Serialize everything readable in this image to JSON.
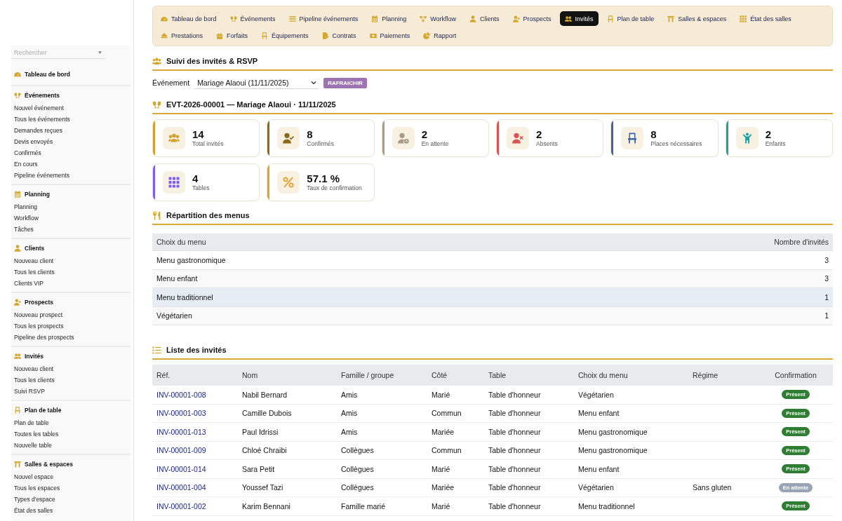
{
  "nav": {
    "tabs": [
      {
        "label": "Tableau de bord",
        "selected": false
      },
      {
        "label": "Événements",
        "selected": false
      },
      {
        "label": "Pipeline événements",
        "selected": false
      },
      {
        "label": "Planning",
        "selected": false
      },
      {
        "label": "Workflow",
        "selected": false
      },
      {
        "label": "Clients",
        "selected": false
      },
      {
        "label": "Prospects",
        "selected": false
      },
      {
        "label": "Invités",
        "selected": true
      },
      {
        "label": "Plan de table",
        "selected": false
      },
      {
        "label": "Salles & espaces",
        "selected": false
      },
      {
        "label": "État des salles",
        "selected": false
      },
      {
        "label": "Prestations",
        "selected": false
      },
      {
        "label": "Forfaits",
        "selected": false
      },
      {
        "label": "Équipements",
        "selected": false
      },
      {
        "label": "Contrats",
        "selected": false
      },
      {
        "label": "Paiements",
        "selected": false
      },
      {
        "label": "Rapport",
        "selected": false
      }
    ]
  },
  "sidebar": {
    "search": {
      "placeholder": "Rechercher"
    },
    "groups": [
      {
        "label": "Tableau de bord"
      },
      {
        "label": "Événements",
        "items": [
          "Nouvel événement",
          "Tous les événements",
          "Demandes reçues",
          "Devis envoyés",
          "Confirmés",
          "En cours",
          "Pipeline événements"
        ]
      },
      {
        "label": "Planning",
        "items": [
          "Planning",
          "Workflow",
          "Tâches"
        ]
      },
      {
        "label": "Clients",
        "items": [
          "Nouveau client",
          "Tous les clients",
          "Clients VIP"
        ]
      },
      {
        "label": "Prospects",
        "items": [
          "Nouveau prospect",
          "Tous les prospects",
          "Pipeline des prospects"
        ]
      },
      {
        "label": "Invités",
        "items": [
          "Nouveau client",
          "Tous les clients",
          "Suivi RSVP"
        ]
      },
      {
        "label": "Plan de table",
        "items": [
          "Plan de table",
          "Toutes les tables",
          "Nouvelle table"
        ]
      },
      {
        "label": "Salles & espaces",
        "items": [
          "Nouvel espace",
          "Tous les espaces",
          "Types d'espace",
          "État des salles"
        ]
      }
    ]
  },
  "page": {
    "title": "Suivi des invités & RSVP"
  },
  "event_picker": {
    "label": "Événement",
    "value": "Mariage Alaoui (11/11/2025)",
    "button": "RAFRAICHIR"
  },
  "event": {
    "title": "EVT-2026-00001 — Mariage Alaoui · 11/11/2025"
  },
  "stats": [
    {
      "value": "14",
      "label": "Total invités",
      "color": "#cfa22e"
    },
    {
      "value": "8",
      "label": "Confirmés",
      "color": "#8a6a17"
    },
    {
      "value": "2",
      "label": "En attente",
      "color": "#a89c86"
    },
    {
      "value": "2",
      "label": "Absents",
      "color": "#d9534f"
    },
    {
      "value": "8",
      "label": "Places nécessaires",
      "color": "#3f63a6"
    },
    {
      "value": "2",
      "label": "Enfants",
      "color": "#1aa3a3"
    },
    {
      "value": "4",
      "label": "Tables",
      "color": "#7c5cf2"
    },
    {
      "value": "57.1 %",
      "label": "Taux de confirmation",
      "color": "#e2a12f"
    }
  ],
  "menu_section": {
    "title": "Répartition des menus",
    "columns": [
      "Choix du menu",
      "Nombre d'invités"
    ],
    "rows": [
      {
        "cells": [
          "Menu gastronomique",
          "3"
        ],
        "highlighted": false
      },
      {
        "cells": [
          "Menu enfant",
          "3"
        ],
        "highlighted": false
      },
      {
        "cells": [
          "Menu traditionnel",
          "1"
        ],
        "highlighted": true
      },
      {
        "cells": [
          "Végétarien",
          "1"
        ],
        "highlighted": false
      }
    ]
  },
  "guest_section": {
    "title": "Liste des invités",
    "columns": [
      "Réf.",
      "Nom",
      "Famille / groupe",
      "Côté",
      "Table",
      "Choix du menu",
      "Régime",
      "Confirmation"
    ],
    "rows": [
      {
        "ref": "INV-00001-008",
        "name": "Nabil Bernard",
        "group": "Amis",
        "side": "Marié",
        "table": "Table d'honneur",
        "menu": "Végétarien",
        "confirmation": {
          "label": "Présent",
          "color": "#2e7d32"
        }
      },
      {
        "ref": "INV-00001-003",
        "name": "Camille Dubois",
        "group": "Amis",
        "side": "Commun",
        "table": "Table d'honneur",
        "menu": "Menu enfant",
        "confirmation": {
          "label": "Présent",
          "color": "#2e7d32"
        }
      },
      {
        "ref": "INV-00001-013",
        "name": "Paul Idrissi",
        "group": "Amis",
        "side": "Mariée",
        "table": "Table d'honneur",
        "menu": "Menu gastronomique",
        "confirmation": {
          "label": "Présent",
          "color": "#2e7d32"
        }
      },
      {
        "ref": "INV-00001-009",
        "name": "Chloé Chraibi",
        "group": "Collègues",
        "side": "Commun",
        "table": "Table d'honneur",
        "menu": "Menu gastronomique",
        "confirmation": {
          "label": "Présent",
          "color": "#2e7d32"
        }
      },
      {
        "ref": "INV-00001-014",
        "name": "Sara Petit",
        "group": "Collègues",
        "side": "Marié",
        "table": "Table d'honneur",
        "menu": "Menu enfant",
        "confirmation": {
          "label": "Présent",
          "color": "#2e7d32"
        }
      },
      {
        "ref": "INV-00001-004",
        "name": "Youssef Tazi",
        "group": "Collègues",
        "side": "Mariée",
        "table": "Table d'honneur",
        "menu": "Végétarien",
        "diet": "Sans gluten",
        "confirmation": {
          "label": "En attente",
          "color": "#98a4b6"
        }
      },
      {
        "ref": "INV-00001-002",
        "name": "Karim Bennani",
        "group": "Famille marié",
        "side": "Marié",
        "table": "Table d'honneur",
        "menu": "Menu traditionnel",
        "confirmation": {
          "label": "Présent",
          "color": "#2e7d32"
        }
      }
    ]
  }
}
